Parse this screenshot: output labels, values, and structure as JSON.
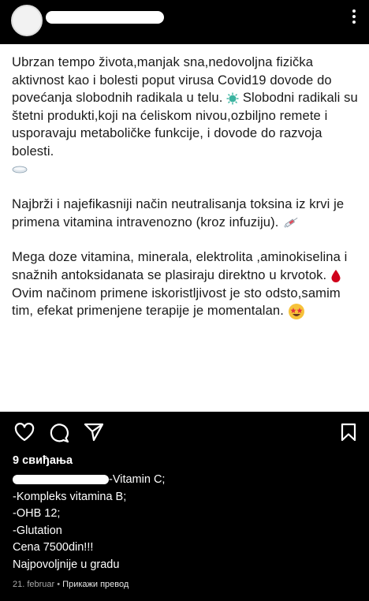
{
  "post": {
    "paragraphs": [
      {
        "text": "Ubrzan tempo života,manjak sna,nedovoljna fizička aktivnost kao i bolesti poput virusa Covid19 dovode do povećanja slobodnih radikala u telu.",
        "icon": "virus-icon"
      },
      {
        "text": "Slobodni radikali su štetni produkti,koji na ćeliskom nivou,ozbiljno remete i usporavaju metaboličke funkcije, i dovode do razvoja bolesti.",
        "icon": "pill-icon"
      },
      {
        "text": "Najbrži i najefikasniji način neutralisanja toksina iz krvi je primena vitamina intravenozno (kroz infuziju).",
        "icon": "syringe-icon"
      },
      {
        "text": "Mega doze vitamina, minerala, elektrolita ,aminokiselina i snažnih antoksidanata se plasiraju direktno u krvotok.",
        "icon": "blood-drop-icon"
      },
      {
        "text": "Ovim načinom primene iskoristljivost je sto odsto,samim tim, efekat primenjene terapije je momentalan.",
        "icon": "star-struck-icon"
      }
    ]
  },
  "likes": "9 свиђања",
  "caption": {
    "lines": [
      "-Vitamin C;",
      "-Kompleks vitamina B;",
      "-OHB 12;",
      "-Glutation",
      "Cena 7500din!!!",
      "Najpovoljnije u gradu"
    ]
  },
  "meta": {
    "date": "21. februar",
    "separator": " • ",
    "translate": "Прикажи превод"
  },
  "colors": {
    "background": "#000000",
    "post_bg": "#ffffff",
    "text": "#1a1a1a",
    "virus": "#3bb3a0",
    "drop": "#d0021b"
  }
}
